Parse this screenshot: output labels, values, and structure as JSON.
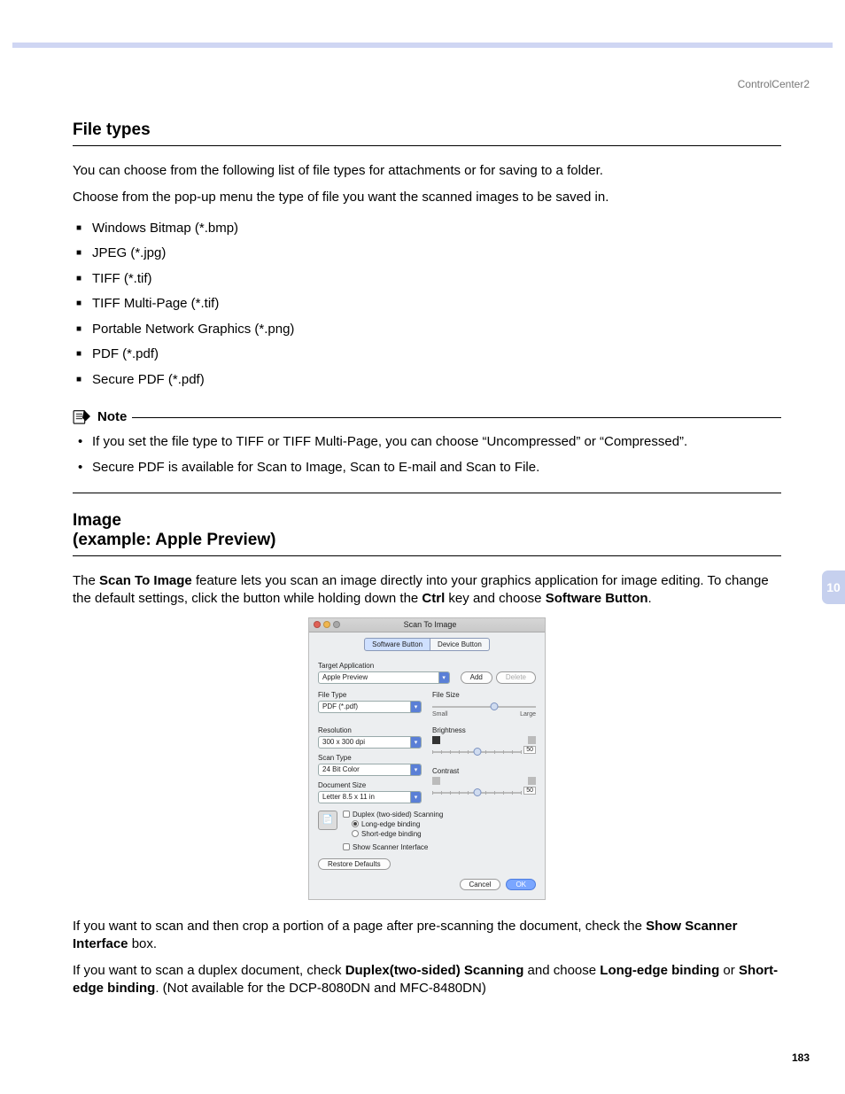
{
  "header": {
    "product": "ControlCenter2"
  },
  "thumb": {
    "chapter": "10"
  },
  "footer": {
    "page": "183"
  },
  "section1": {
    "title": "File types",
    "intro1": "You can choose from the following list of file types for attachments or for saving to a folder.",
    "intro2": "Choose from the pop-up menu the type of file you want the scanned images to be saved in.",
    "items": [
      "Windows Bitmap (*.bmp)",
      "JPEG (*.jpg)",
      "TIFF (*.tif)",
      "TIFF Multi-Page (*.tif)",
      "Portable Network Graphics (*.png)",
      "PDF (*.pdf)",
      "Secure PDF (*.pdf)"
    ]
  },
  "note": {
    "label": "Note",
    "items": [
      "If you set the file type to TIFF or TIFF Multi-Page, you can choose “Uncompressed” or “Compressed”.",
      "Secure PDF is available for Scan to Image, Scan to E-mail and Scan to File."
    ]
  },
  "section2": {
    "title_line1": "Image",
    "title_line2": "(example: Apple Preview)",
    "p1_pre": "The ",
    "p1_b1": "Scan To Image",
    "p1_mid": " feature lets you scan an image directly into your graphics application for image editing. To change the default settings, click the button while holding down the ",
    "p1_b2": "Ctrl",
    "p1_mid2": " key and choose ",
    "p1_b3": "Software Button",
    "p1_end": ".",
    "p2_pre": "If you want to scan and then crop a portion of a page after pre-scanning the document, check the ",
    "p2_b1": "Show Scanner Interface",
    "p2_end": " box.",
    "p3_pre": "If you want to scan a duplex document, check ",
    "p3_b1": "Duplex(two-sided) Scanning",
    "p3_mid": " and choose ",
    "p3_b2": "Long-edge binding",
    "p3_mid2": " or ",
    "p3_b3": "Short-edge binding",
    "p3_end": ". (Not available for the DCP-8080DN and MFC-8480DN)"
  },
  "dialog": {
    "title": "Scan To Image",
    "tabs": {
      "software": "Software Button",
      "device": "Device Button"
    },
    "labels": {
      "target_app": "Target Application",
      "file_type": "File Type",
      "file_size": "File Size",
      "resolution": "Resolution",
      "brightness": "Brightness",
      "scan_type": "Scan Type",
      "contrast": "Contrast",
      "doc_size": "Document Size",
      "small": "Small",
      "large": "Large",
      "duplex": "Duplex (two-sided) Scanning",
      "long_edge": "Long-edge binding",
      "short_edge": "Short-edge binding",
      "show_scanner": "Show Scanner Interface"
    },
    "values": {
      "target_app": "Apple Preview",
      "file_type": "PDF (*.pdf)",
      "resolution": "300 x 300 dpi",
      "scan_type": "24 Bit Color",
      "doc_size": "Letter  8.5 x 11 in",
      "brightness": "50",
      "contrast": "50"
    },
    "buttons": {
      "add": "Add",
      "delete": "Delete",
      "restore": "Restore Defaults",
      "cancel": "Cancel",
      "ok": "OK"
    }
  }
}
